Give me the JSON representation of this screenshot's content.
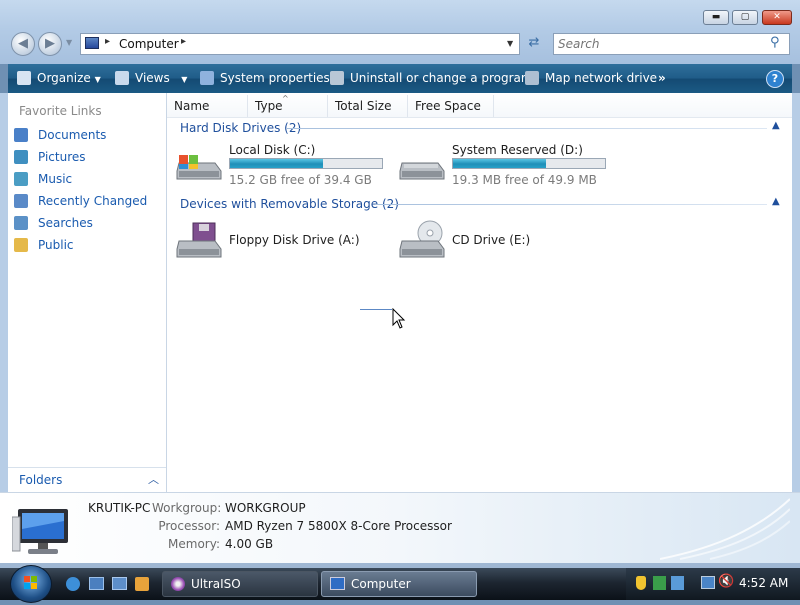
{
  "window": {
    "caption_buttons": [
      "minimize",
      "maximize",
      "close"
    ]
  },
  "navigation": {
    "back_icon": "back-arrow-icon",
    "forward_icon": "forward-arrow-icon"
  },
  "address_bar": {
    "location": "Computer",
    "separator_glyph": "▸"
  },
  "search": {
    "placeholder": "Search"
  },
  "toolbar": {
    "organize": "Organize",
    "views": "Views",
    "system_properties": "System properties",
    "uninstall": "Uninstall or change a program",
    "map_drive": "Map network drive",
    "more": "»",
    "help": "?"
  },
  "sidebar": {
    "header": "Favorite Links",
    "items": [
      {
        "label": "Documents",
        "icon": "documents-icon",
        "color": "#4a80c8"
      },
      {
        "label": "Pictures",
        "icon": "pictures-icon",
        "color": "#3f8fc0"
      },
      {
        "label": "Music",
        "icon": "music-icon",
        "color": "#4b9dc4"
      },
      {
        "label": "Recently Changed",
        "icon": "recently-changed-icon",
        "color": "#5a8ac8"
      },
      {
        "label": "Searches",
        "icon": "searches-icon",
        "color": "#5b91c7"
      },
      {
        "label": "Public",
        "icon": "public-folder-icon",
        "color": "#e5b94a"
      }
    ],
    "folders_label": "Folders"
  },
  "columns": {
    "name": "Name",
    "type": "Type",
    "total_size": "Total Size",
    "free_space": "Free Space"
  },
  "groups": {
    "hard_disks": {
      "title": "Hard Disk Drives (2)",
      "drives": [
        {
          "name": "Local Disk (C:)",
          "free_text": "15.2 GB free of 39.4 GB",
          "used_fraction": 0.61
        },
        {
          "name": "System Reserved (D:)",
          "free_text": "19.3 MB free of 49.9 MB",
          "used_fraction": 0.61
        }
      ]
    },
    "removable": {
      "title": "Devices with Removable Storage (2)",
      "drives": [
        {
          "name": "Floppy Disk Drive (A:)"
        },
        {
          "name": "CD Drive (E:)"
        }
      ]
    }
  },
  "details": {
    "computer_name": "KRUTIK-PC",
    "workgroup_label": "Workgroup:",
    "workgroup_value": "WORKGROUP",
    "processor_label": "Processor:",
    "processor_value": "AMD Ryzen 7 5800X 8-Core Processor",
    "memory_label": "Memory:",
    "memory_value": "4.00 GB"
  },
  "taskbar": {
    "tasks": [
      {
        "label": "UltraISO",
        "active": false
      },
      {
        "label": "Computer",
        "active": true
      }
    ],
    "clock": "4:52 AM"
  },
  "colors": {
    "link": "#1a5baf",
    "group_header": "#1f4f9c",
    "toolbar_bg": "#1f5c88",
    "capacity_fill": "#1f8fb8"
  }
}
